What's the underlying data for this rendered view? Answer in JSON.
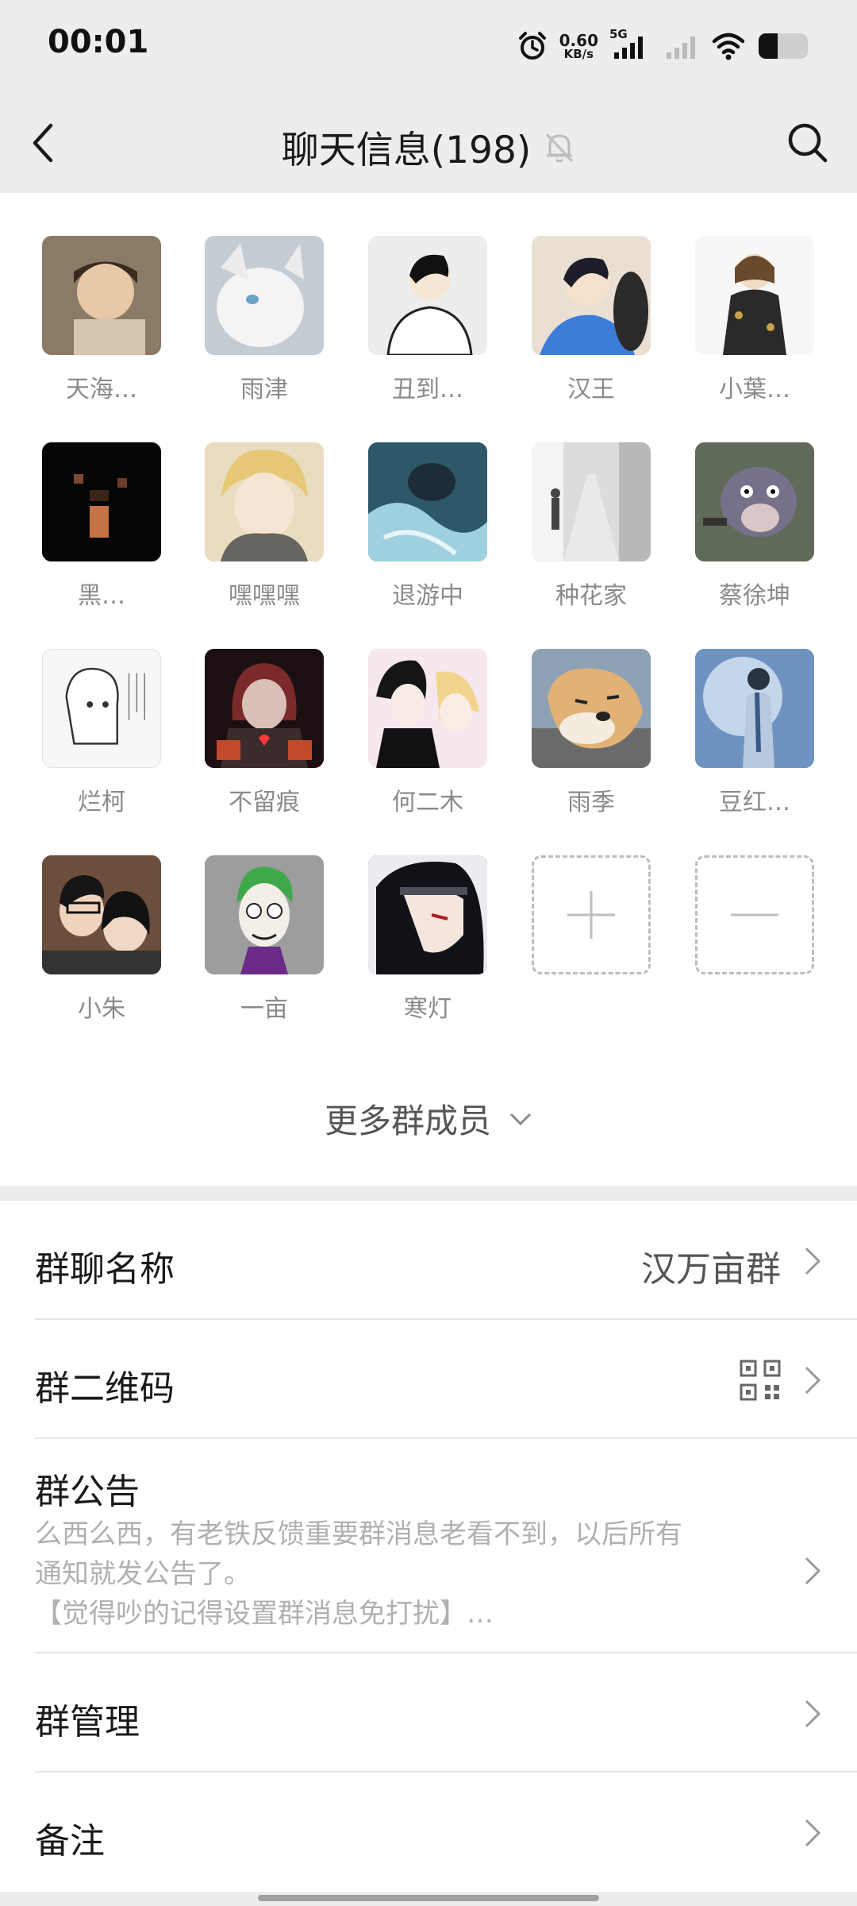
{
  "status_bar": {
    "time": "00:01",
    "net_speed_value": "0.60",
    "net_speed_unit": "KB/s",
    "network": "5G",
    "icons": [
      "alarm-icon",
      "signal-icon",
      "wifi-icon",
      "battery-icon"
    ]
  },
  "nav": {
    "title": "聊天信息(198)",
    "back_icon": "back-arrow-icon",
    "mute_icon": "bell-muted-icon",
    "search_icon": "search-icon"
  },
  "members": [
    {
      "name": "天海…",
      "color": "#b8a58e"
    },
    {
      "name": "雨津",
      "color": "#cfd6de"
    },
    {
      "name": "丑到…",
      "color": "#ececec"
    },
    {
      "name": "汉王",
      "color": "#e8ddd0"
    },
    {
      "name": "小葉…",
      "color": "#f2f2f2"
    },
    {
      "name": "黑…",
      "color": "#050505"
    },
    {
      "name": "嘿嘿嘿",
      "color": "#d8c08a"
    },
    {
      "name": "退游中",
      "color": "#3c6e7e"
    },
    {
      "name": "种花家",
      "color": "#c9c9c9"
    },
    {
      "name": "蔡徐坤",
      "color": "#6f7868"
    },
    {
      "name": "烂柯",
      "color": "#f5f5f3"
    },
    {
      "name": "不留痕",
      "color": "#2a1418"
    },
    {
      "name": "何二木",
      "color": "#f1e4e9"
    },
    {
      "name": "雨季",
      "color": "#9aa9b8"
    },
    {
      "name": "豆红…",
      "color": "#7ea0c7"
    },
    {
      "name": "小朱",
      "color": "#8e6a52"
    },
    {
      "name": "一亩",
      "color": "#9a9a9a"
    },
    {
      "name": "寒灯",
      "color": "#1b1b24"
    }
  ],
  "member_actions": {
    "add_icon": "plus-icon",
    "remove_icon": "minus-icon"
  },
  "more_members": {
    "label": "更多群成员",
    "icon": "chevron-down-icon"
  },
  "settings": {
    "group_name": {
      "label": "群聊名称",
      "value": "汉万亩群"
    },
    "qr_code": {
      "label": "群二维码",
      "icon": "qr-code-icon"
    },
    "announcement": {
      "label": "群公告",
      "text_line1": "么西么西，有老铁反馈重要群消息老看不到，以后所有",
      "text_line2": "通知就发公告了。",
      "text_line3": "【觉得吵的记得设置群消息免打扰】…"
    },
    "management": {
      "label": "群管理"
    },
    "remark": {
      "label": "备注"
    }
  },
  "accent_colors": {
    "background": "#ededed",
    "card": "#ffffff",
    "muted_text": "#8a8a8a"
  }
}
